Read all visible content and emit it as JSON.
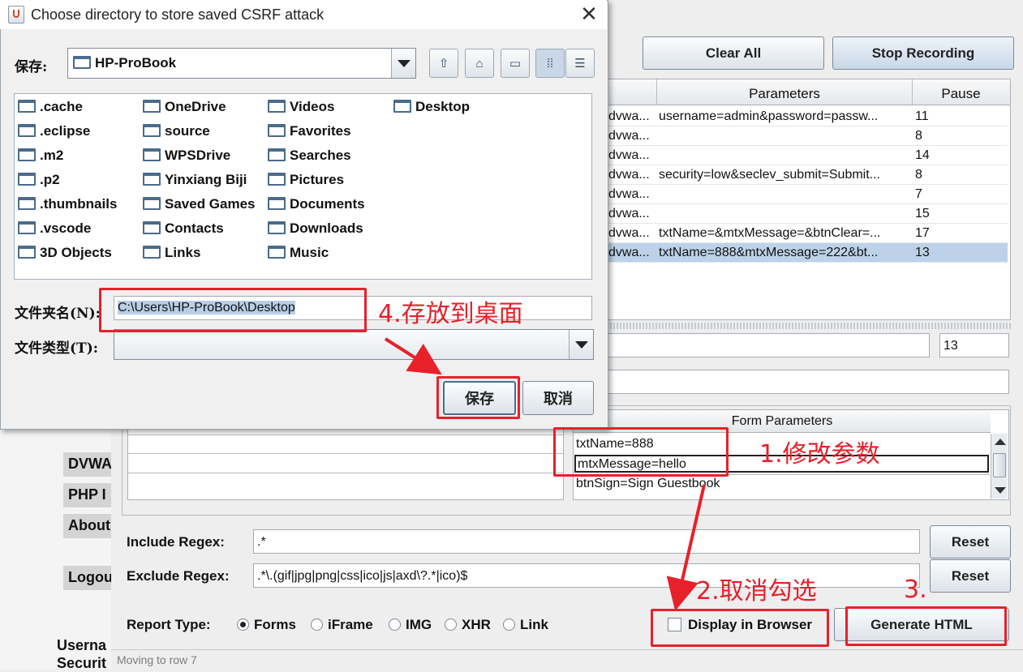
{
  "dialog": {
    "title": "Choose directory to store saved CSRF attack",
    "look_in_label": "保存:",
    "look_in_value": "HP-ProBook",
    "files": [
      [
        ".cache",
        ".eclipse",
        ".m2",
        ".p2",
        ".thumbnails",
        ".vscode",
        "3D Objects"
      ],
      [
        "OneDrive",
        "source",
        "WPSDrive",
        "Yinxiang Biji",
        "Saved Games",
        "Contacts",
        "Links"
      ],
      [
        "Videos",
        "Favorites",
        "Searches",
        "Pictures",
        "Documents",
        "Downloads",
        "Music"
      ],
      [
        "Desktop"
      ]
    ],
    "folder_name_label": "文件夹名(N):",
    "folder_name_value": "C:\\Users\\HP-ProBook\\Desktop",
    "file_type_label": "文件类型(T):",
    "save_label": "保存",
    "cancel_label": "取消"
  },
  "main": {
    "clear_all_label": "Clear All",
    "stop_recording_label": "Stop Recording",
    "table": {
      "columns": [
        "Parameters",
        "Pause"
      ],
      "rows": [
        {
          "url": "dvwa...",
          "params": "username=admin&password=passw...",
          "pause": "11"
        },
        {
          "url": "dvwa...",
          "params": "",
          "pause": "8"
        },
        {
          "url": "dvwa...",
          "params": "",
          "pause": "14"
        },
        {
          "url": "dvwa...",
          "params": "security=low&seclev_submit=Submit...",
          "pause": "8"
        },
        {
          "url": "dvwa...",
          "params": "",
          "pause": "7"
        },
        {
          "url": "dvwa...",
          "params": "",
          "pause": "15"
        },
        {
          "url": "dvwa...",
          "params": "txtName=&mtxMessage=&btnClear=...",
          "pause": "17"
        },
        {
          "url": "dvwa...",
          "params": "txtName=888&mtxMessage=222&bt...",
          "pause": "13"
        }
      ]
    },
    "pause_value": "13",
    "form_parameters_header": "Form Parameters",
    "form_parameters": [
      "txtName=888",
      "mtxMessage=hello",
      "btnSign=Sign Guestbook"
    ],
    "include_regex_label": "Include Regex:",
    "include_regex_value": ".*",
    "exclude_regex_label": "Exclude Regex:",
    "exclude_regex_value": ".*\\.(gif|jpg|png|css|ico|js|axd\\?.*|ico)$",
    "reset_label": "Reset",
    "report_type_label": "Report Type:",
    "report_types": [
      "Forms",
      "iFrame",
      "IMG",
      "XHR",
      "Link"
    ],
    "report_type_selected": "Forms",
    "display_in_browser_label": "Display in Browser",
    "generate_html_label": "Generate HTML",
    "status_text": "Moving to row 7",
    "sidebar_items": [
      "DVWA",
      "PHP I",
      "About",
      "Logou"
    ],
    "bottom_text": [
      "Userna",
      "Securit"
    ]
  },
  "annotations": {
    "step1": "1.修改参数",
    "step2": "2.取消勾选",
    "step3": "3.",
    "step4": "4.存放到桌面",
    "color": "#e8202a"
  }
}
